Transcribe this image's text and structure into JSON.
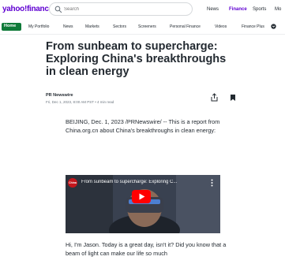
{
  "header": {
    "logo_text": "yahoo!finance",
    "search_placeholder": "Search",
    "nav_links": [
      "News",
      "Finance",
      "Sports",
      "Mo"
    ],
    "active_nav": "Finance"
  },
  "subnav": {
    "home_label": "Home",
    "items": [
      "My Portfolio",
      "News",
      "Markets",
      "Sectors",
      "Screeners",
      "Personal Finance",
      "Videos",
      "Finance Plus"
    ]
  },
  "article": {
    "headline": "From sunbeam to supercharge: Exploring China's breakthroughs in clean energy",
    "source": "PR Newswire",
    "dateline": "Fri, Dec 1, 2023, 8:00 AM PST • 4 min read",
    "paragraph1": "BEIJING, Dec. 1, 2023 /PRNewswire/ -- This is a report from China.org.cn about China's breakthroughs in clean energy:",
    "paragraph2": "Hi, I'm Jason. Today is a great day, isn't it? Did you know that a beam of light can make our life so much"
  },
  "video": {
    "title": "From sunbeam to supercharge: Exploring C...",
    "channel_badge": "China"
  },
  "colors": {
    "brand": "#6001d2",
    "home_green": "#0f7a39",
    "play_red": "#ff0000"
  },
  "icons": [
    "search-icon",
    "share-icon",
    "bookmark-icon",
    "play-icon",
    "more-icon"
  ]
}
